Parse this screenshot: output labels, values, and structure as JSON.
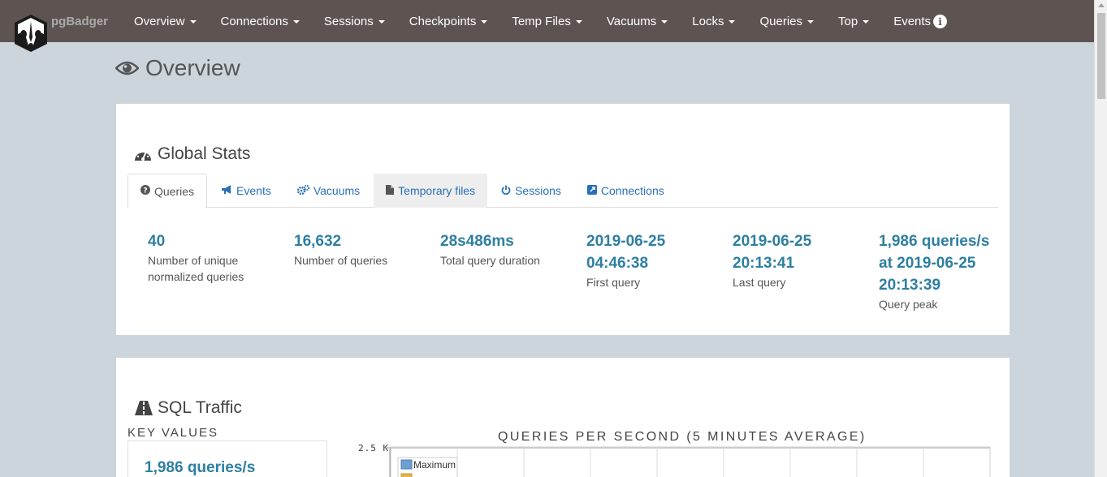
{
  "brand": {
    "name": "pgBadger"
  },
  "nav": {
    "items": [
      {
        "label": "Overview"
      },
      {
        "label": "Connections"
      },
      {
        "label": "Sessions"
      },
      {
        "label": "Checkpoints"
      },
      {
        "label": "Temp Files"
      },
      {
        "label": "Vacuums"
      },
      {
        "label": "Locks"
      },
      {
        "label": "Queries"
      },
      {
        "label": "Top"
      },
      {
        "label": "Events"
      }
    ],
    "info_icon": "info-icon"
  },
  "page": {
    "title": "Overview",
    "title_icon": "eye-icon"
  },
  "global_stats": {
    "title": "Global Stats",
    "tabs": [
      {
        "label": "Queries",
        "icon": "question-circle-icon"
      },
      {
        "label": "Events",
        "icon": "bullhorn-icon"
      },
      {
        "label": "Vacuums",
        "icon": "gears-icon"
      },
      {
        "label": "Temporary files",
        "icon": "file-icon"
      },
      {
        "label": "Sessions",
        "icon": "power-icon"
      },
      {
        "label": "Connections",
        "icon": "external-link-icon"
      }
    ],
    "stats": [
      {
        "value": "40",
        "label": "Number of unique normalized queries"
      },
      {
        "value": "16,632",
        "label": "Number of queries"
      },
      {
        "value": "28s486ms",
        "label": "Total query duration"
      },
      {
        "value": "2019-06-25 04:46:38",
        "label": "First query"
      },
      {
        "value": "2019-06-25 20:13:41",
        "label": "Last query"
      },
      {
        "value": "1,986 queries/s at 2019-06-25 20:13:39",
        "label": "Query peak"
      }
    ]
  },
  "sql_traffic": {
    "title": "SQL Traffic",
    "key_values_label": "KEY VALUES",
    "key_value": "1,986 queries/s"
  },
  "chart_data": {
    "type": "line",
    "title": "QUERIES PER SECOND (5 MINUTES AVERAGE)",
    "y_tick_labels": [
      "2.5 K"
    ],
    "series": [
      {
        "name": "Maximum",
        "color": "#6d9fd1"
      },
      {
        "name": "",
        "color": "#e6b34a"
      }
    ]
  },
  "colors": {
    "navbar": "#5d5452",
    "accent": "#2e7fa1",
    "link": "#2a6fb5",
    "background": "#cdd5dc"
  }
}
